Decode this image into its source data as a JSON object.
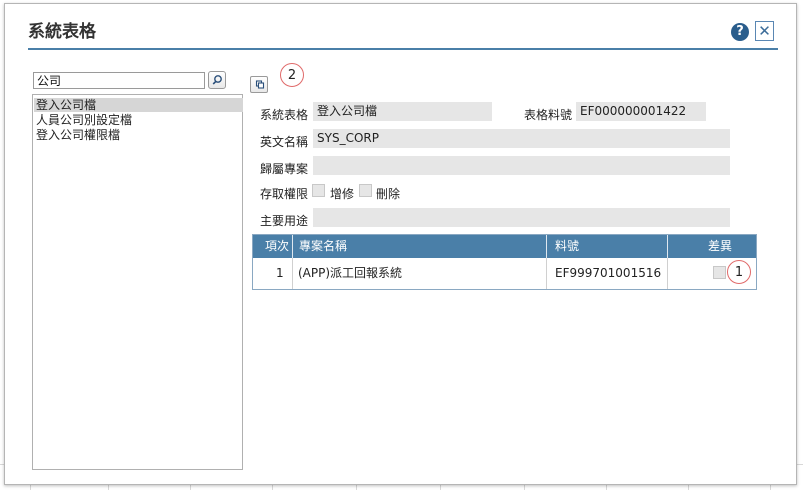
{
  "dialog": {
    "title": "系統表格",
    "help_glyph": "?",
    "close_glyph": "✕"
  },
  "left_panel": {
    "search_value": "公司",
    "items": [
      {
        "label": "登入公司檔",
        "selected": true
      },
      {
        "label": "人員公司別設定檔",
        "selected": false
      },
      {
        "label": "登入公司權限檔",
        "selected": false
      }
    ]
  },
  "form": {
    "table_name_label": "系統表格",
    "table_name_value": "登入公司檔",
    "material_no_label": "表格料號",
    "material_no_value": "EF000000001422",
    "english_name_label": "英文名稱",
    "english_name_value": "SYS_CORP",
    "project_label": "歸屬專案",
    "project_value": "",
    "access_label": "存取權限",
    "access_add_edit_label": "增修",
    "access_delete_label": "刪除",
    "purpose_label": "主要用途",
    "purpose_value": ""
  },
  "grid": {
    "headers": {
      "index": "項次",
      "project_name": "專案名稱",
      "material_no": "料號",
      "diff": "差異"
    },
    "rows": [
      {
        "index": "1",
        "project_name": "(APP)派工回報系統",
        "material_no": "EF999701001516",
        "diff": false
      }
    ]
  },
  "callouts": {
    "first": "1",
    "second": "2"
  },
  "colors": {
    "accent": "#4a7fa8",
    "header_bg": "#4a7fa8",
    "callout_border": "#e06a6a",
    "selected_row": "#d6d6d6"
  },
  "icons": [
    "help-icon",
    "close-icon",
    "search-icon",
    "copy-icon"
  ]
}
